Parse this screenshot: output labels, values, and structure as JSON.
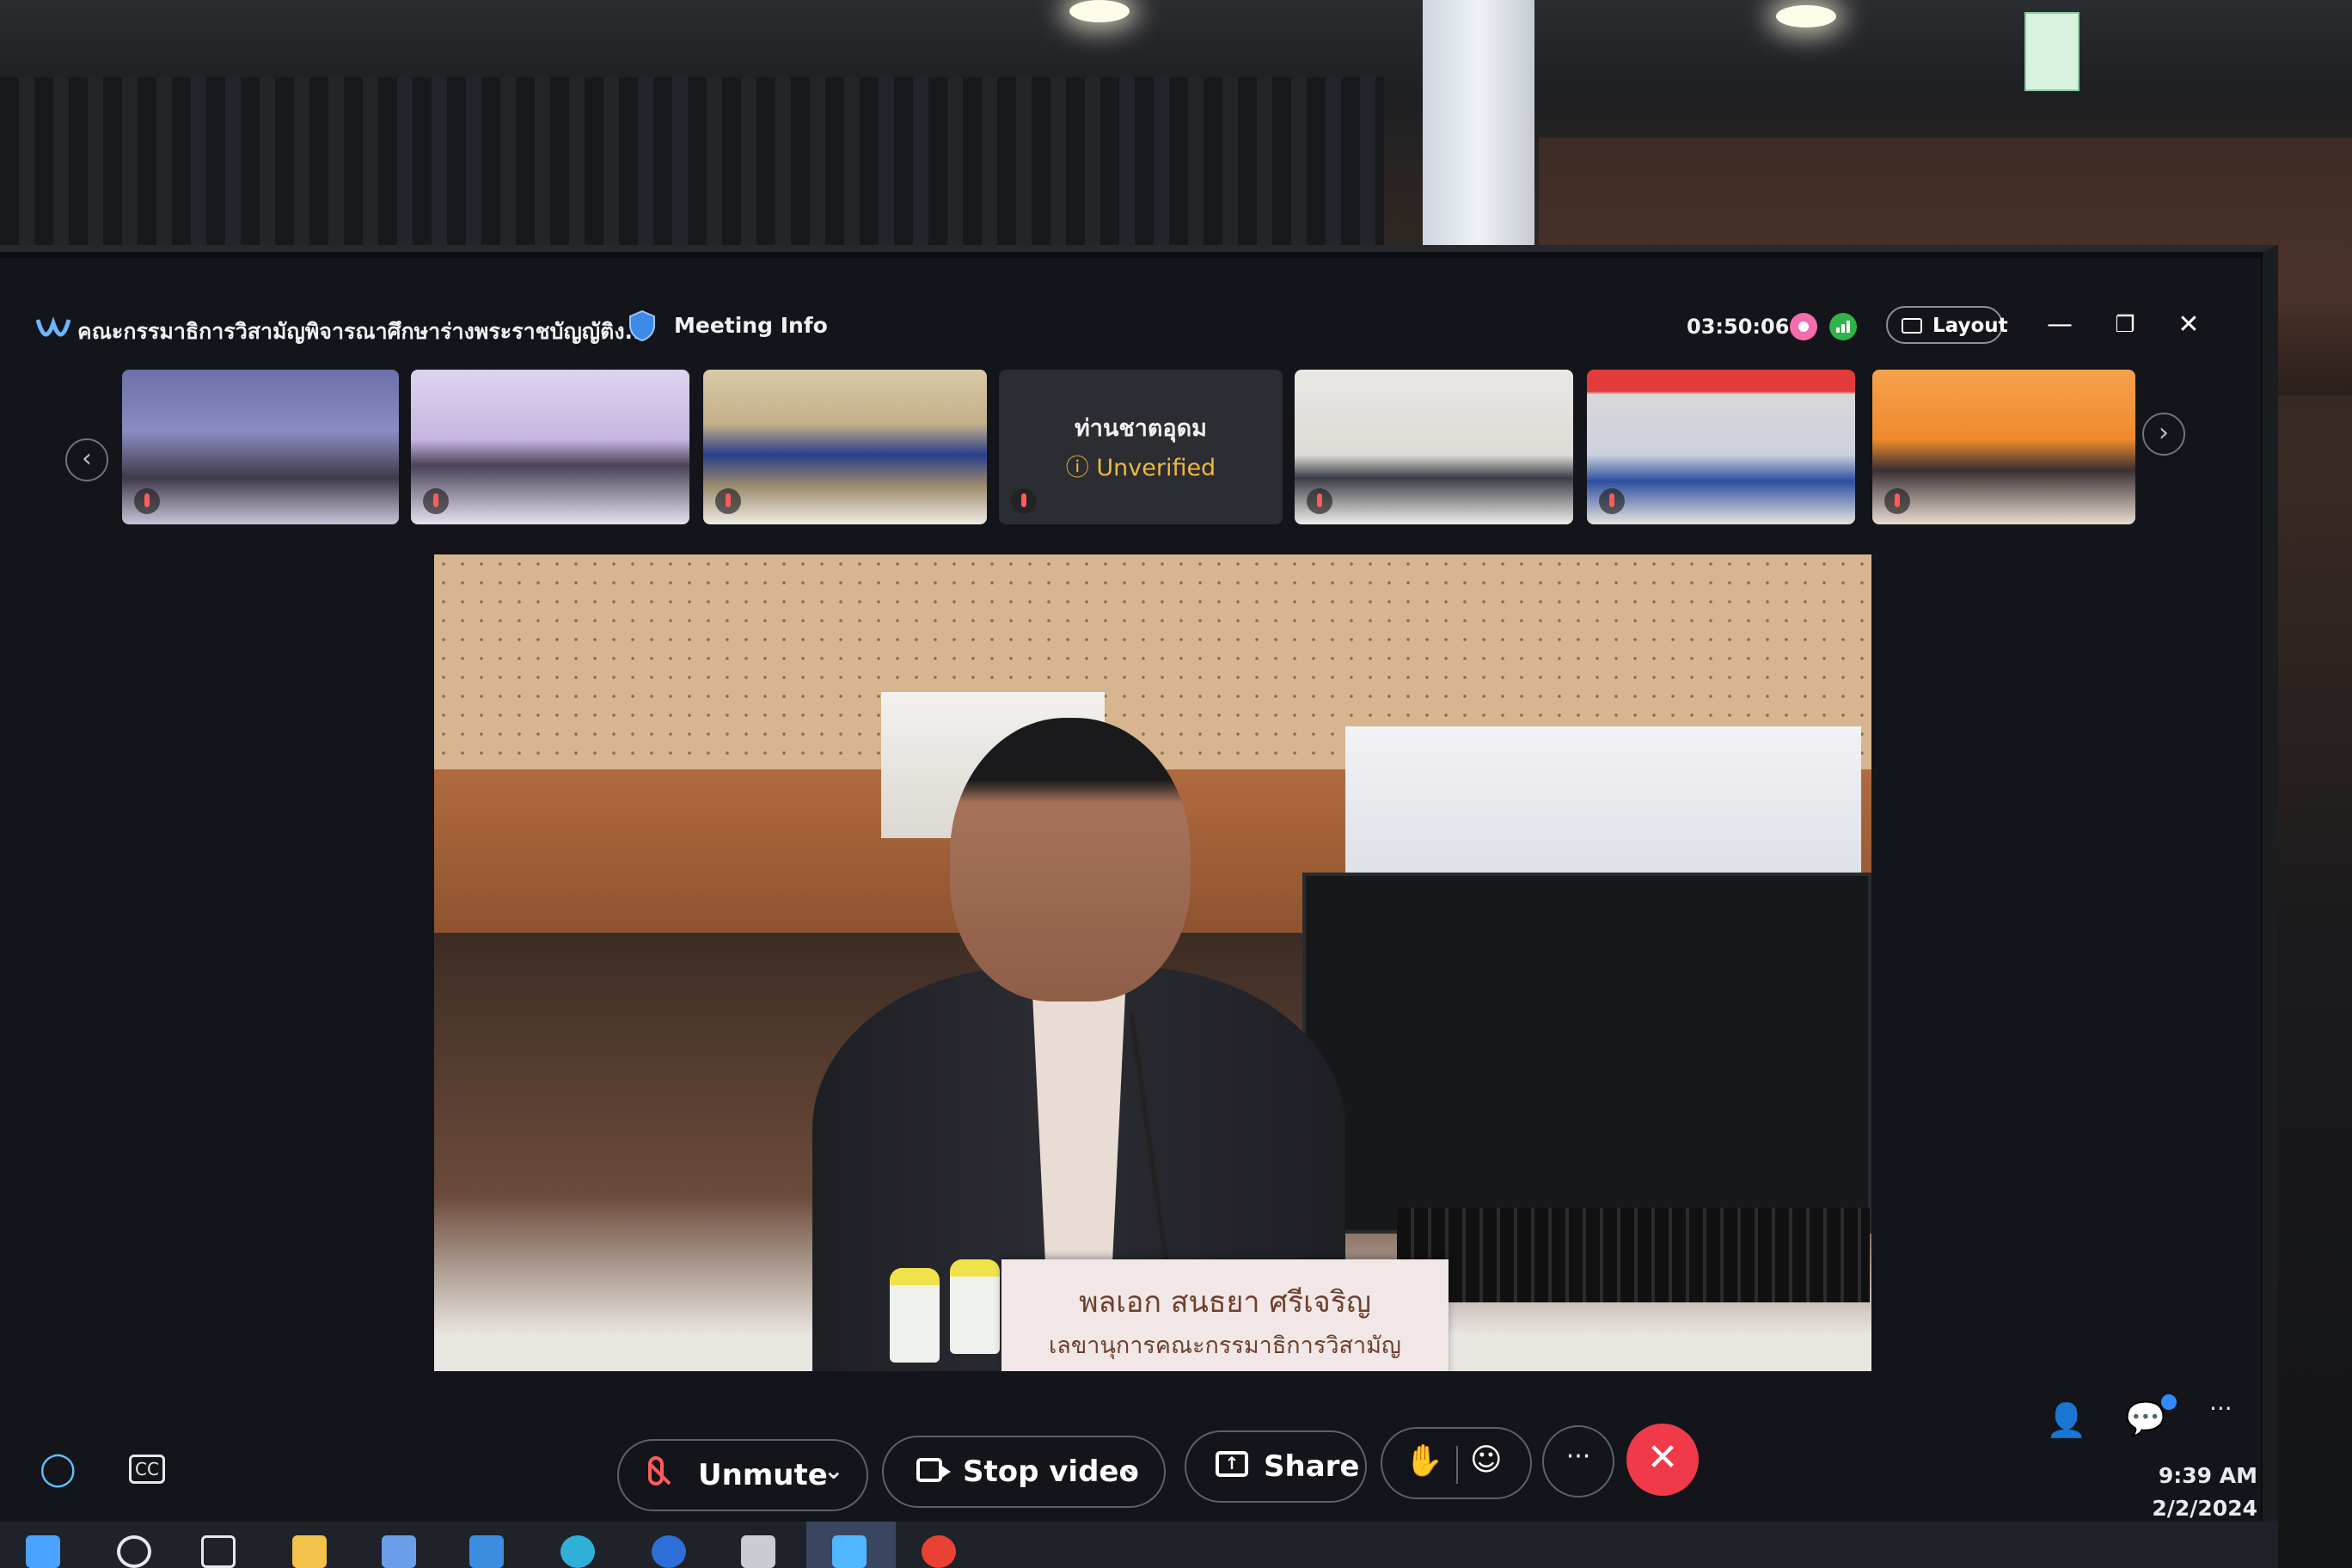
{
  "window": {
    "title": "คณะกรรมาธิการวิสามัญพิจารณาศึกษาร่างพระราชบัญญัติง...",
    "meeting_info_label": "Meeting Info",
    "elapsed_time": "03:50:06",
    "layout_label": "Layout",
    "minimize_symbol": "—",
    "restore_symbol": "❐",
    "close_symbol": "✕"
  },
  "participants_strip": {
    "prev_symbol": "‹",
    "next_symbol": "›",
    "placeholder_tile": {
      "name": "ท่านชาตอุดม",
      "status": "Unverified",
      "status_symbol": "ⓘ"
    }
  },
  "main_video": {
    "nameplate_name": "พลเอก สนธยา ศรีเจริญ",
    "nameplate_title": "เลขานุการคณะกรรมาธิการวิสามัญ"
  },
  "controls": {
    "unmute_label": "Unmute",
    "stop_video_label": "Stop video",
    "share_label": "Share",
    "chevron": "⌄",
    "hand_symbol": "✋",
    "reaction_symbol": "☺",
    "more_symbol": "···",
    "end_symbol": "✕",
    "overflow_symbol": "···",
    "participants_symbol": "👤",
    "chat_symbol": "💬",
    "assistant_symbol": "◯",
    "captions_symbol": "CC"
  },
  "taskbar": {
    "time": "9:39 AM",
    "date": "2/2/2024"
  },
  "colors": {
    "end_call": "#f03a4a",
    "muted_mic": "#ff5b5b",
    "unverified": "#f0b840",
    "recording": "#f36cae",
    "network": "#2fb34a"
  }
}
